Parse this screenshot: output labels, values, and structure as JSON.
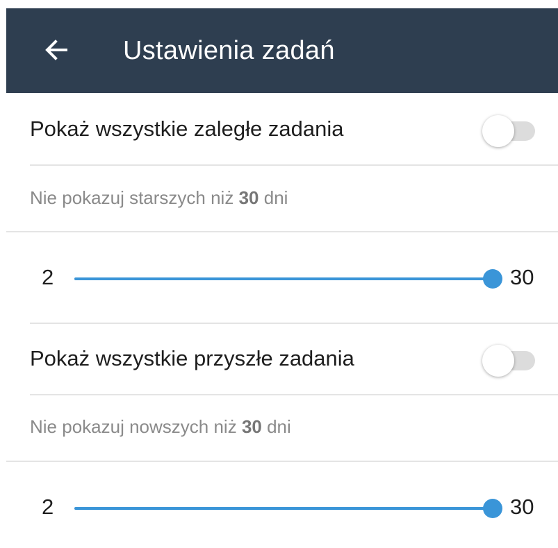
{
  "header": {
    "title": "Ustawienia zadań",
    "background": "#2e3e50",
    "back_icon": "arrow-left-icon"
  },
  "overdue": {
    "label": "Pokaż wszystkie zaległe zadania",
    "toggle_on": false,
    "hint_prefix": "Nie pokazuj starszych niż",
    "hint_value": "30",
    "hint_suffix": "dni",
    "slider": {
      "min_label": "2",
      "max_label": "30",
      "min": 2,
      "max": 30,
      "value": 30
    }
  },
  "future": {
    "label": "Pokaż wszystkie przyszłe zadania",
    "toggle_on": false,
    "hint_prefix": "Nie pokazuj nowszych niż",
    "hint_value": "30",
    "hint_suffix": "dni",
    "slider": {
      "min_label": "2",
      "max_label": "30",
      "min": 2,
      "max": 30,
      "value": 30
    }
  },
  "accent": "#3a95d8"
}
